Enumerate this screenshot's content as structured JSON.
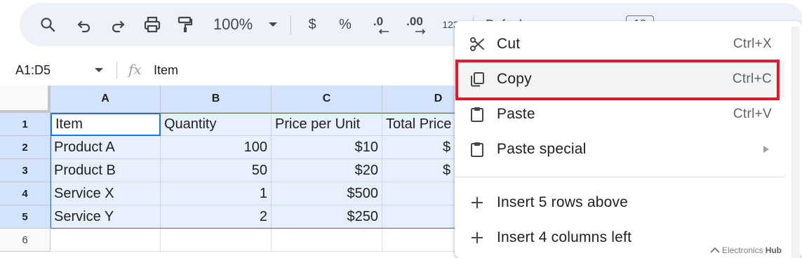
{
  "toolbar": {
    "zoom": "100%",
    "currency": "$",
    "percent": "%",
    "decimal_decrease": ".0",
    "decimal_increase": ".00",
    "more_formats": "123",
    "font": "Defaul",
    "font_size": "10"
  },
  "formula_bar": {
    "name_box": "A1:D5",
    "fx": "fx",
    "content": "Item"
  },
  "sheet": {
    "columns": [
      "A",
      "B",
      "C",
      "D"
    ],
    "rows": [
      "1",
      "2",
      "3",
      "4",
      "5",
      "6"
    ],
    "cells": [
      [
        "Item",
        "Quantity",
        "Price per Unit",
        "Total Price"
      ],
      [
        "Product A",
        "100",
        "$10",
        "$"
      ],
      [
        "Product B",
        "50",
        "$20",
        "$"
      ],
      [
        "Service X",
        "1",
        "$500",
        ""
      ],
      [
        "Service Y",
        "2",
        "$250",
        ""
      ],
      [
        "",
        "",
        "",
        ""
      ]
    ]
  },
  "context_menu": {
    "items": [
      {
        "label": "Cut",
        "shortcut": "Ctrl+X",
        "icon": "scissors-icon"
      },
      {
        "label": "Copy",
        "shortcut": "Ctrl+C",
        "icon": "copy-icon"
      },
      {
        "label": "Paste",
        "shortcut": "Ctrl+V",
        "icon": "clipboard-icon"
      },
      {
        "label": "Paste special",
        "shortcut": "",
        "icon": "clipboard-icon"
      },
      {
        "label": "Insert 5 rows above",
        "shortcut": "",
        "icon": "plus-icon"
      },
      {
        "label": "Insert 4 columns left",
        "shortcut": "",
        "icon": "plus-icon"
      }
    ]
  },
  "colors": {
    "toolbar_bg": "#edf2fa",
    "selection_fill": "#e8f0fe",
    "header_selected": "#d3e3fd",
    "selection_border": "#1a73e8",
    "highlight_box": "#e3192b"
  },
  "watermark": {
    "prefix": "Electronics",
    "suffix": "Hub"
  }
}
